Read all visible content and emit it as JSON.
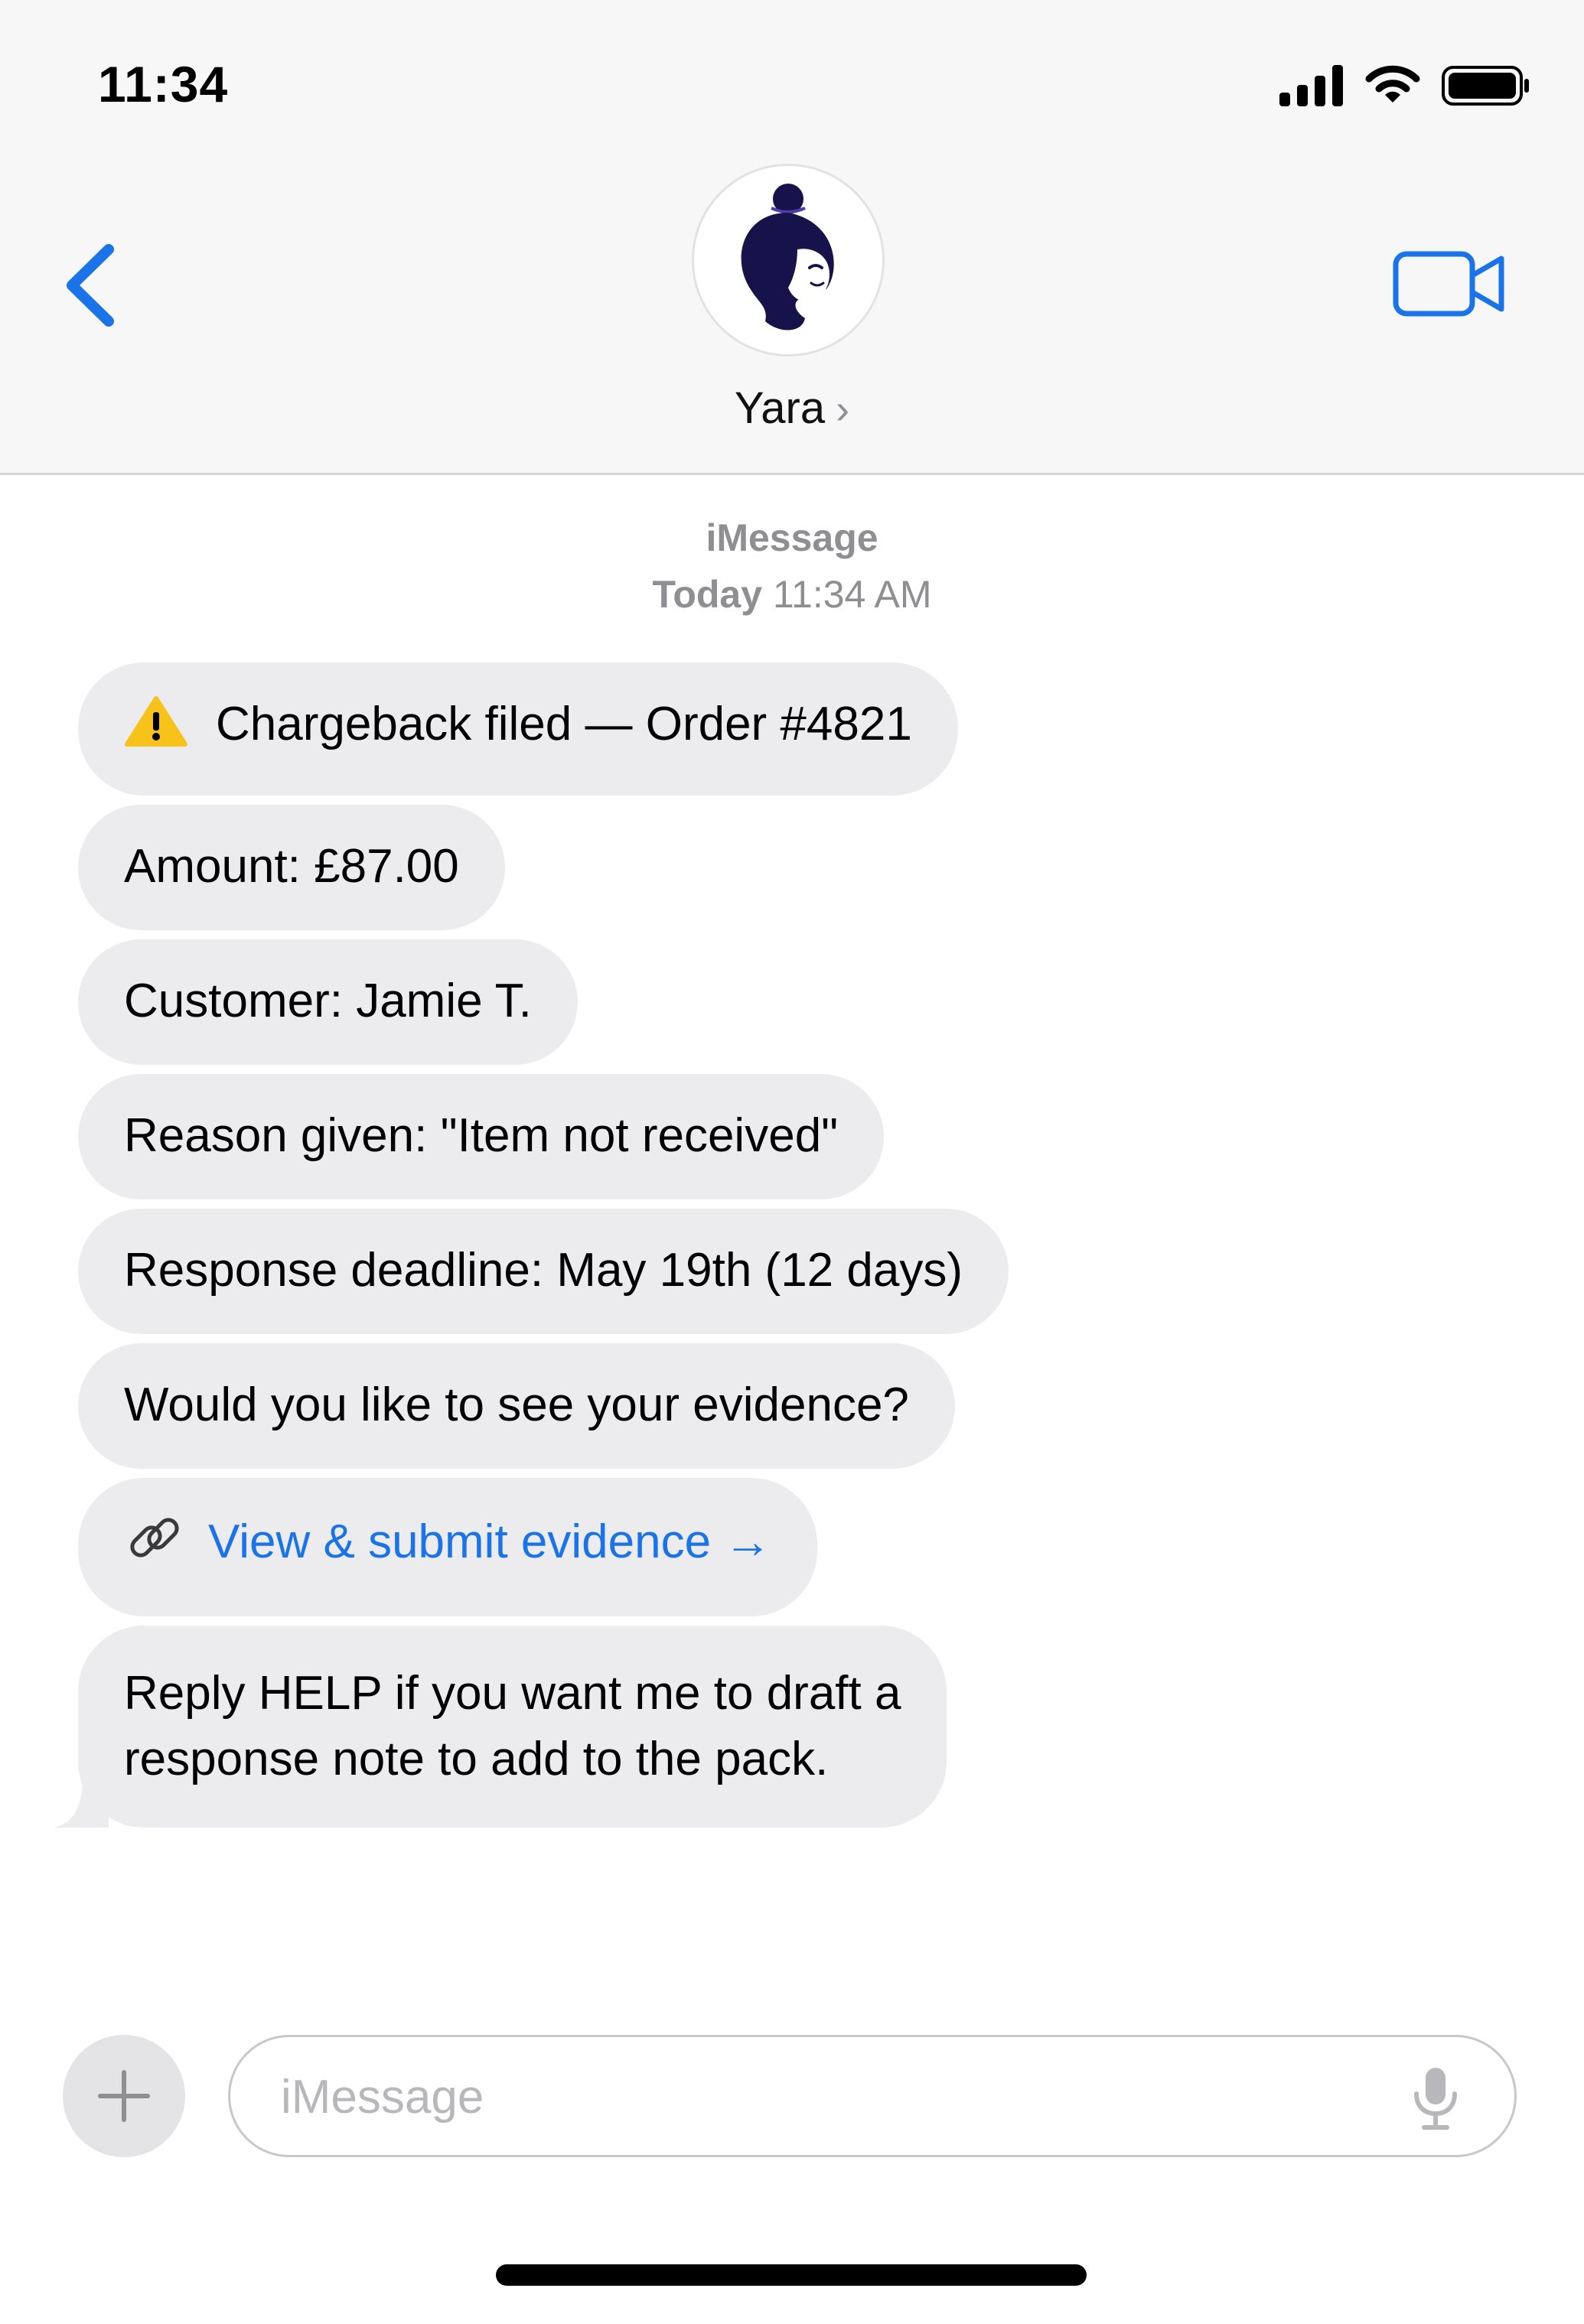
{
  "status_bar": {
    "time": "11:34"
  },
  "header": {
    "contact_name": "Yara",
    "contact_chevron": "›",
    "icons": {
      "back": "chevron-left-icon",
      "video": "video-camera-icon",
      "avatar": "woman-avatar-icon"
    }
  },
  "conversation": {
    "service_label": "iMessage",
    "timestamp_day": "Today",
    "timestamp_time": "11:34 AM",
    "messages": [
      {
        "text": "Chargeback filed — Order #4821",
        "icon": "warning-icon"
      },
      {
        "text": "Amount: £87.00"
      },
      {
        "text": "Customer: Jamie T."
      },
      {
        "text": "Reason given: \"Item not received\""
      },
      {
        "text": "Response deadline: May 19th (12 days)"
      },
      {
        "text": "Would you like to see your evidence?"
      },
      {
        "text": "View & submit evidence →",
        "icon": "link-icon",
        "is_link": true
      },
      {
        "text_line1": "Reply HELP if you want me to draft a",
        "text_line2": "response note to add to the pack."
      }
    ]
  },
  "composer": {
    "placeholder": "iMessage",
    "value": ""
  },
  "colors": {
    "accent": "#1a73e8",
    "bubble": "#ececee",
    "secondary_text": "#8e8e93",
    "avatar_navy": "#16124a"
  }
}
